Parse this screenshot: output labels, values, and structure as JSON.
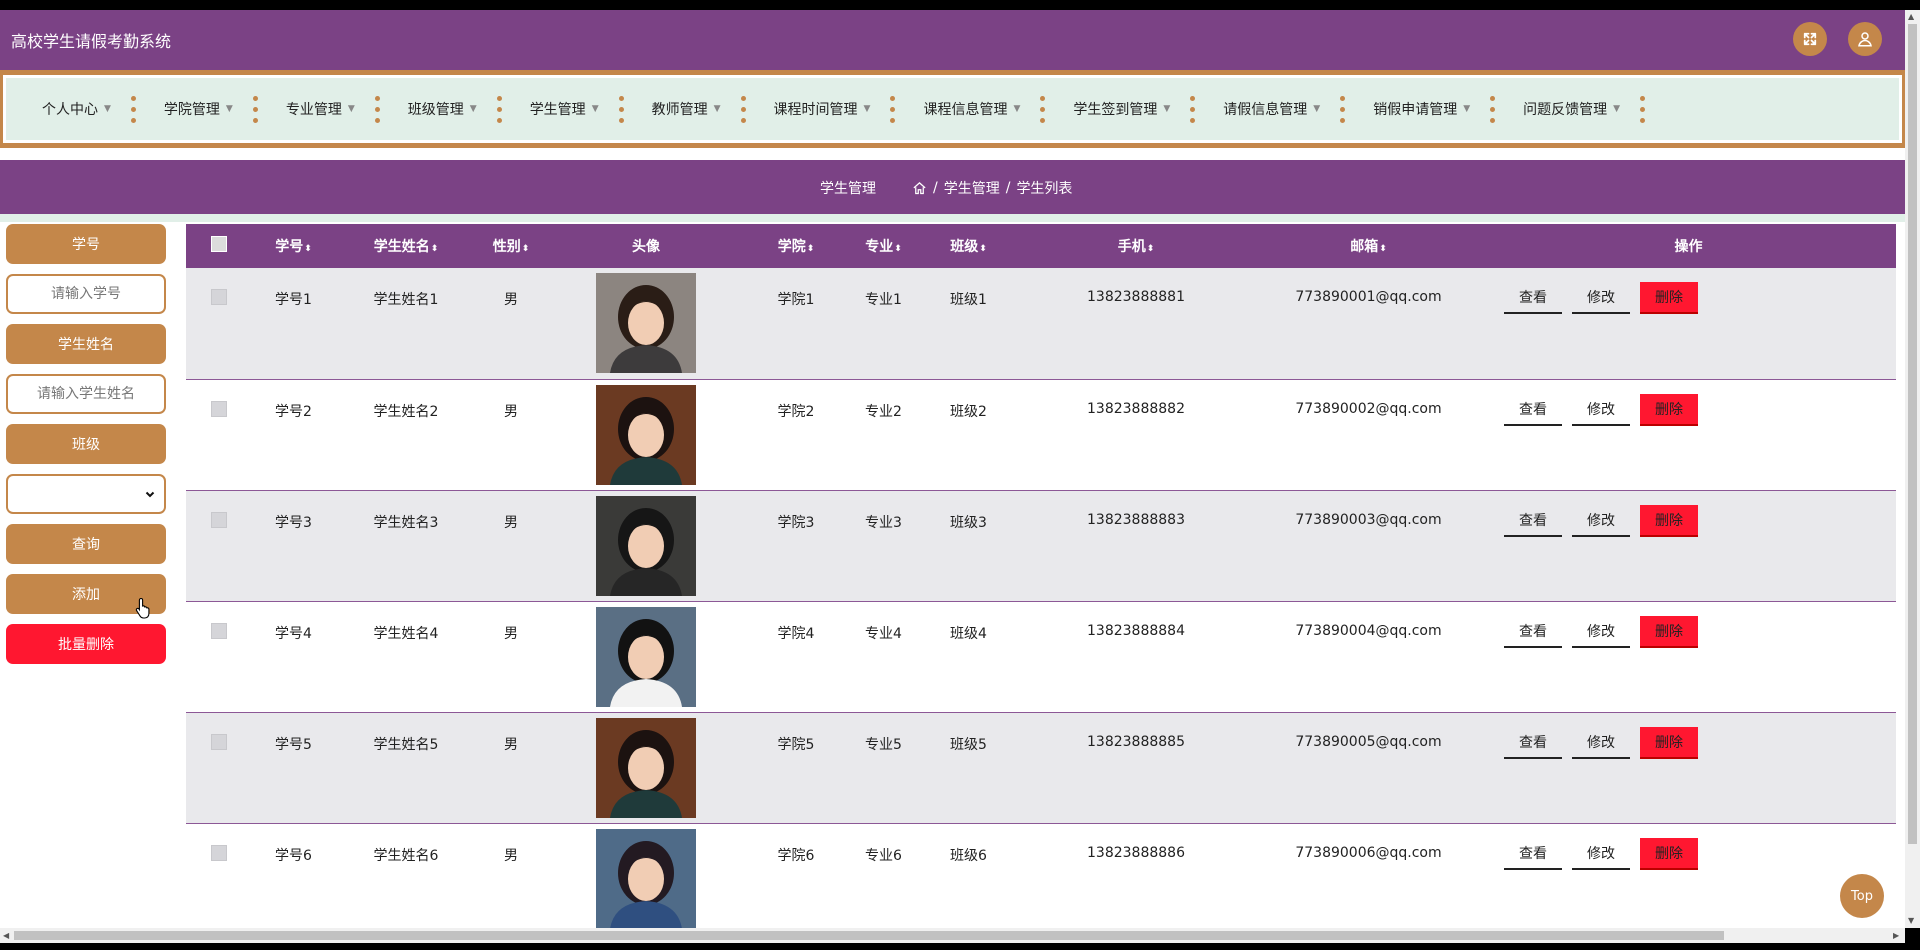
{
  "app": {
    "title": "高校学生请假考勤系统"
  },
  "header_icons": {
    "fullscreen": "fullscreen-icon",
    "user": "user-icon"
  },
  "nav": {
    "items": [
      {
        "label": "个人中心"
      },
      {
        "label": "学院管理"
      },
      {
        "label": "专业管理"
      },
      {
        "label": "班级管理"
      },
      {
        "label": "学生管理"
      },
      {
        "label": "教师管理"
      },
      {
        "label": "课程时间管理"
      },
      {
        "label": "课程信息管理"
      },
      {
        "label": "学生签到管理"
      },
      {
        "label": "请假信息管理"
      },
      {
        "label": "销假申请管理"
      },
      {
        "label": "问题反馈管理"
      }
    ],
    "caret": "▼"
  },
  "breadcrumb": {
    "page_title": "学生管理",
    "items": [
      "学生管理",
      "学生列表"
    ],
    "separator": "/"
  },
  "sidebar": {
    "student_id_label": "学号",
    "student_id_placeholder": "请输入学号",
    "student_name_label": "学生姓名",
    "student_name_placeholder": "请输入学生姓名",
    "class_label": "班级",
    "class_value": "",
    "query_button": "查询",
    "add_button": "添加",
    "batch_delete_button": "批量删除"
  },
  "table": {
    "sort_glyph": "⬍",
    "headers": {
      "id": "学号",
      "name": "学生姓名",
      "gender": "性别",
      "avatar": "头像",
      "college": "学院",
      "major": "专业",
      "class": "班级",
      "phone": "手机",
      "email": "邮箱",
      "ops": "操作"
    },
    "actions": {
      "view": "查看",
      "edit": "修改",
      "delete": "删除"
    },
    "rows": [
      {
        "id": "学号1",
        "name": "学生姓名1",
        "gender": "男",
        "college": "学院1",
        "major": "专业1",
        "class": "班级1",
        "phone": "13823888881",
        "email": "773890001@qq.com"
      },
      {
        "id": "学号2",
        "name": "学生姓名2",
        "gender": "男",
        "college": "学院2",
        "major": "专业2",
        "class": "班级2",
        "phone": "13823888882",
        "email": "773890002@qq.com"
      },
      {
        "id": "学号3",
        "name": "学生姓名3",
        "gender": "男",
        "college": "学院3",
        "major": "专业3",
        "class": "班级3",
        "phone": "13823888883",
        "email": "773890003@qq.com"
      },
      {
        "id": "学号4",
        "name": "学生姓名4",
        "gender": "男",
        "college": "学院4",
        "major": "专业4",
        "class": "班级4",
        "phone": "13823888884",
        "email": "773890004@qq.com"
      },
      {
        "id": "学号5",
        "name": "学生姓名5",
        "gender": "男",
        "college": "学院5",
        "major": "专业5",
        "class": "班级5",
        "phone": "13823888885",
        "email": "773890005@qq.com"
      },
      {
        "id": "学号6",
        "name": "学生姓名6",
        "gender": "男",
        "college": "学院6",
        "major": "专业6",
        "class": "班级6",
        "phone": "13823888886",
        "email": "773890006@qq.com"
      }
    ]
  },
  "back_to_top": "Top",
  "colors": {
    "primary": "#7b4285",
    "accent": "#c4874a",
    "nav_bg": "#e1efe8",
    "danger": "#ff1730",
    "row_alt": "#e9e9ec"
  }
}
